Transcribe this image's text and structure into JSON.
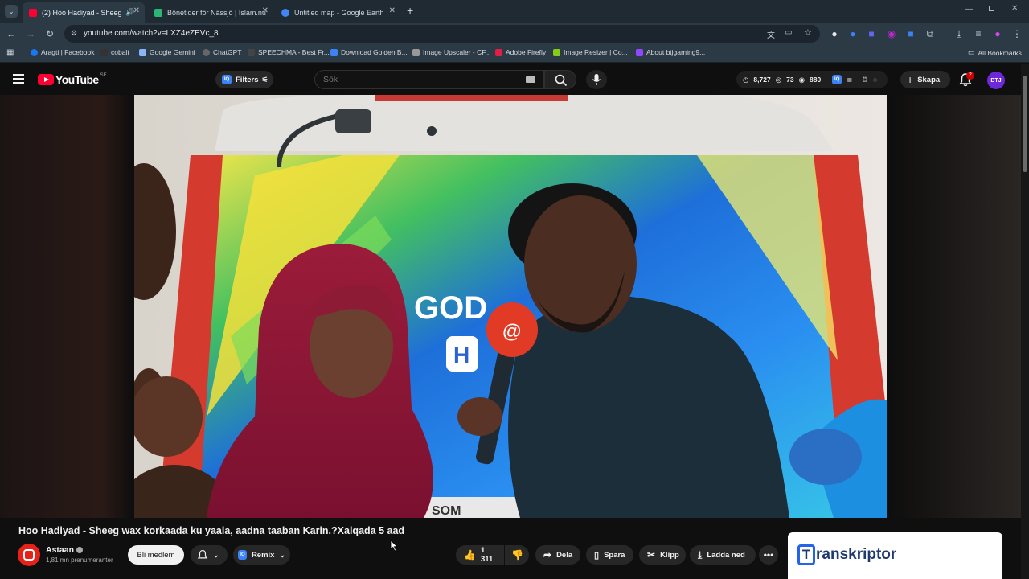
{
  "browser": {
    "tabs": [
      {
        "title": "(2) Hoo Hadiyad - Sheeg w...",
        "active": true,
        "favicon_color": "#ff0033"
      },
      {
        "title": "Bönetider för Nässjö | Islam.nu",
        "active": false,
        "favicon_color": "#2bb673"
      },
      {
        "title": "Untitled map - Google Earth",
        "active": false,
        "favicon_color": "#4285f4"
      }
    ],
    "url": "youtube.com/watch?v=LXZ4eZEVc_8",
    "bookmarks": [
      {
        "label": "Aragti | Facebook",
        "color": "#1877f2"
      },
      {
        "label": "cobalt",
        "color": "#333333"
      },
      {
        "label": "Google Gemini",
        "color": "#8ab4f8"
      },
      {
        "label": "ChatGPT",
        "color": "#666666"
      },
      {
        "label": "SPEECHMA - Best Fr...",
        "color": "#444444"
      },
      {
        "label": "Download Golden B...",
        "color": "#3b82f6"
      },
      {
        "label": "Image Upscaler - CF...",
        "color": "#999999"
      },
      {
        "label": "Adobe Firefly",
        "color": "#e11d48"
      },
      {
        "label": "Image Resizer | Co...",
        "color": "#84cc16"
      },
      {
        "label": "About btjgaming9...",
        "color": "#9146ff"
      }
    ],
    "all_bookmarks": "All Bookmarks"
  },
  "youtube": {
    "logo": "YouTube",
    "country": "SE",
    "filters_label": "Filters",
    "iq_label": "IQ",
    "search_placeholder": "Sök",
    "stats": {
      "time": "8,727",
      "views": "73",
      "eye": "880"
    },
    "create_label": "Skapa",
    "notifications": "2",
    "avatar_initials": "BTJ"
  },
  "video": {
    "title": "Hoo Hadiyad - Sheeg wax korkaada ku yaala, aadna taaban Karin.?Xalqada 5 aad",
    "van_brand": "GOD",
    "van_letter": "H",
    "mic_logo": "@",
    "plate": "SOM"
  },
  "channel": {
    "name": "Astaan",
    "subscribers": "1,81 mn prenumeranter",
    "join_label": "Bli medlem",
    "remix_label": "Remix"
  },
  "actions": {
    "likes": "1 311",
    "share": "Dela",
    "save": "Spara",
    "clip": "Klipp",
    "download": "Ladda ned"
  },
  "overlay": {
    "brand_first": "T",
    "brand_rest": "ranskriptor"
  }
}
